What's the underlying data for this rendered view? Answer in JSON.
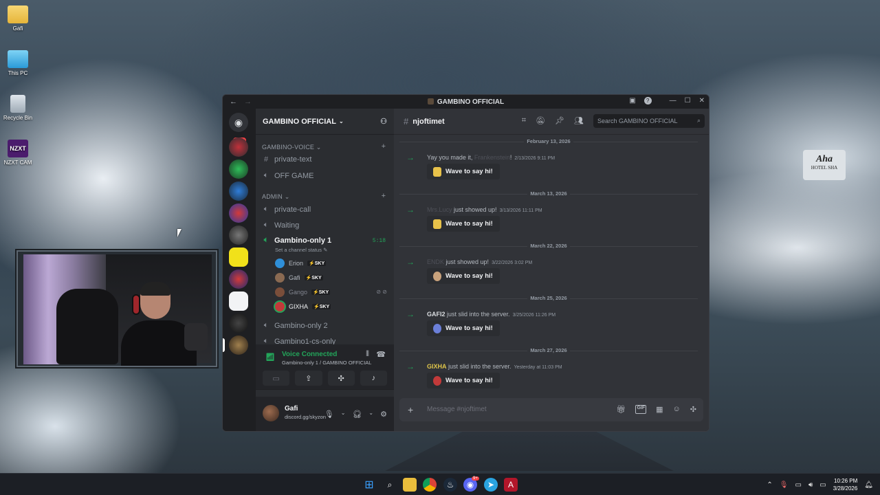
{
  "desktop": {
    "icons": [
      {
        "label": "Gafi"
      },
      {
        "label": "This PC"
      },
      {
        "label": "Recycle Bin"
      },
      {
        "label": "NZXT CAM"
      }
    ],
    "nzxt_logo": "NZXT",
    "sign_text": "Aha",
    "sign_sub": "HOTEL SHA"
  },
  "window": {
    "title": "GAMBINO OFFICIAL",
    "back": "←",
    "forward": "→"
  },
  "rail": {
    "badge": "125"
  },
  "sidebar": {
    "server_name": "GAMBINO OFFICIAL",
    "categories": [
      {
        "label": "GAMBINO-VOICE"
      },
      {
        "label": "ADMIN"
      }
    ],
    "channels": [
      {
        "label": "private-text"
      },
      {
        "label": "OFF GAME"
      },
      {
        "label": "private-call"
      },
      {
        "label": "Waiting"
      },
      {
        "label": "Gambino-only 1"
      },
      {
        "label": "Gambino-only 2"
      },
      {
        "label": "Gambino1-cs-only"
      }
    ],
    "channel_status": "Set a channel status",
    "timer": "5:18",
    "voice_users": [
      {
        "name": "Erion",
        "tag": "SKY",
        "color": "#2f8fd8"
      },
      {
        "name": "Gafi",
        "tag": "SKY",
        "color": "#8a6a52"
      },
      {
        "name": "Gango",
        "tag": "SKY",
        "color": "#7a4e3a"
      },
      {
        "name": "GIXHA",
        "tag": "SKY",
        "color": "#c23a3a"
      }
    ],
    "voice": {
      "status": "Voice Connected",
      "channel": "Gambino-only 1 / GAMBINO OFFICIAL"
    },
    "user": {
      "name": "Gafi",
      "status": "discord.gg/skyzon"
    }
  },
  "main": {
    "channel": "njoftimet",
    "search_placeholder": "Search GAMBINO OFFICIAL",
    "wave_label": "Wave to say hi!",
    "dates": [
      "February 13, 2026",
      "March 13, 2026",
      "March 22, 2026",
      "March 25, 2026",
      "March 27, 2026"
    ],
    "messages": [
      {
        "user": "Frankenstein",
        "pre": "Yay you made it, ",
        "post": "!",
        "time": "2/13/2026 9:11 PM",
        "user_color": "#4e5058"
      },
      {
        "user": "Mrs.Lucy",
        "pre": "",
        "post": " just showed up!",
        "time": "3/13/2026 11:11 PM",
        "user_color": "#4e5058"
      },
      {
        "user": "ENDK",
        "pre": "",
        "post": " just showed up!",
        "time": "3/22/2026 3:02 PM",
        "user_color": "#4e5058"
      },
      {
        "user": "GAFI2",
        "pre": "",
        "post": " just slid into the server.",
        "time": "3/25/2026 11:26 PM",
        "user_color": "#dbdee1"
      },
      {
        "user": "GIXHA",
        "pre": "",
        "post": " just slid into the server.",
        "time": "Yesterday at 11:03 PM",
        "user_color": "#e0c64a"
      }
    ],
    "composer_placeholder": "Message #njoftimet"
  },
  "taskbar": {
    "time": "10:26 PM",
    "date": "3/28/2026",
    "discord_badge": "9+"
  }
}
